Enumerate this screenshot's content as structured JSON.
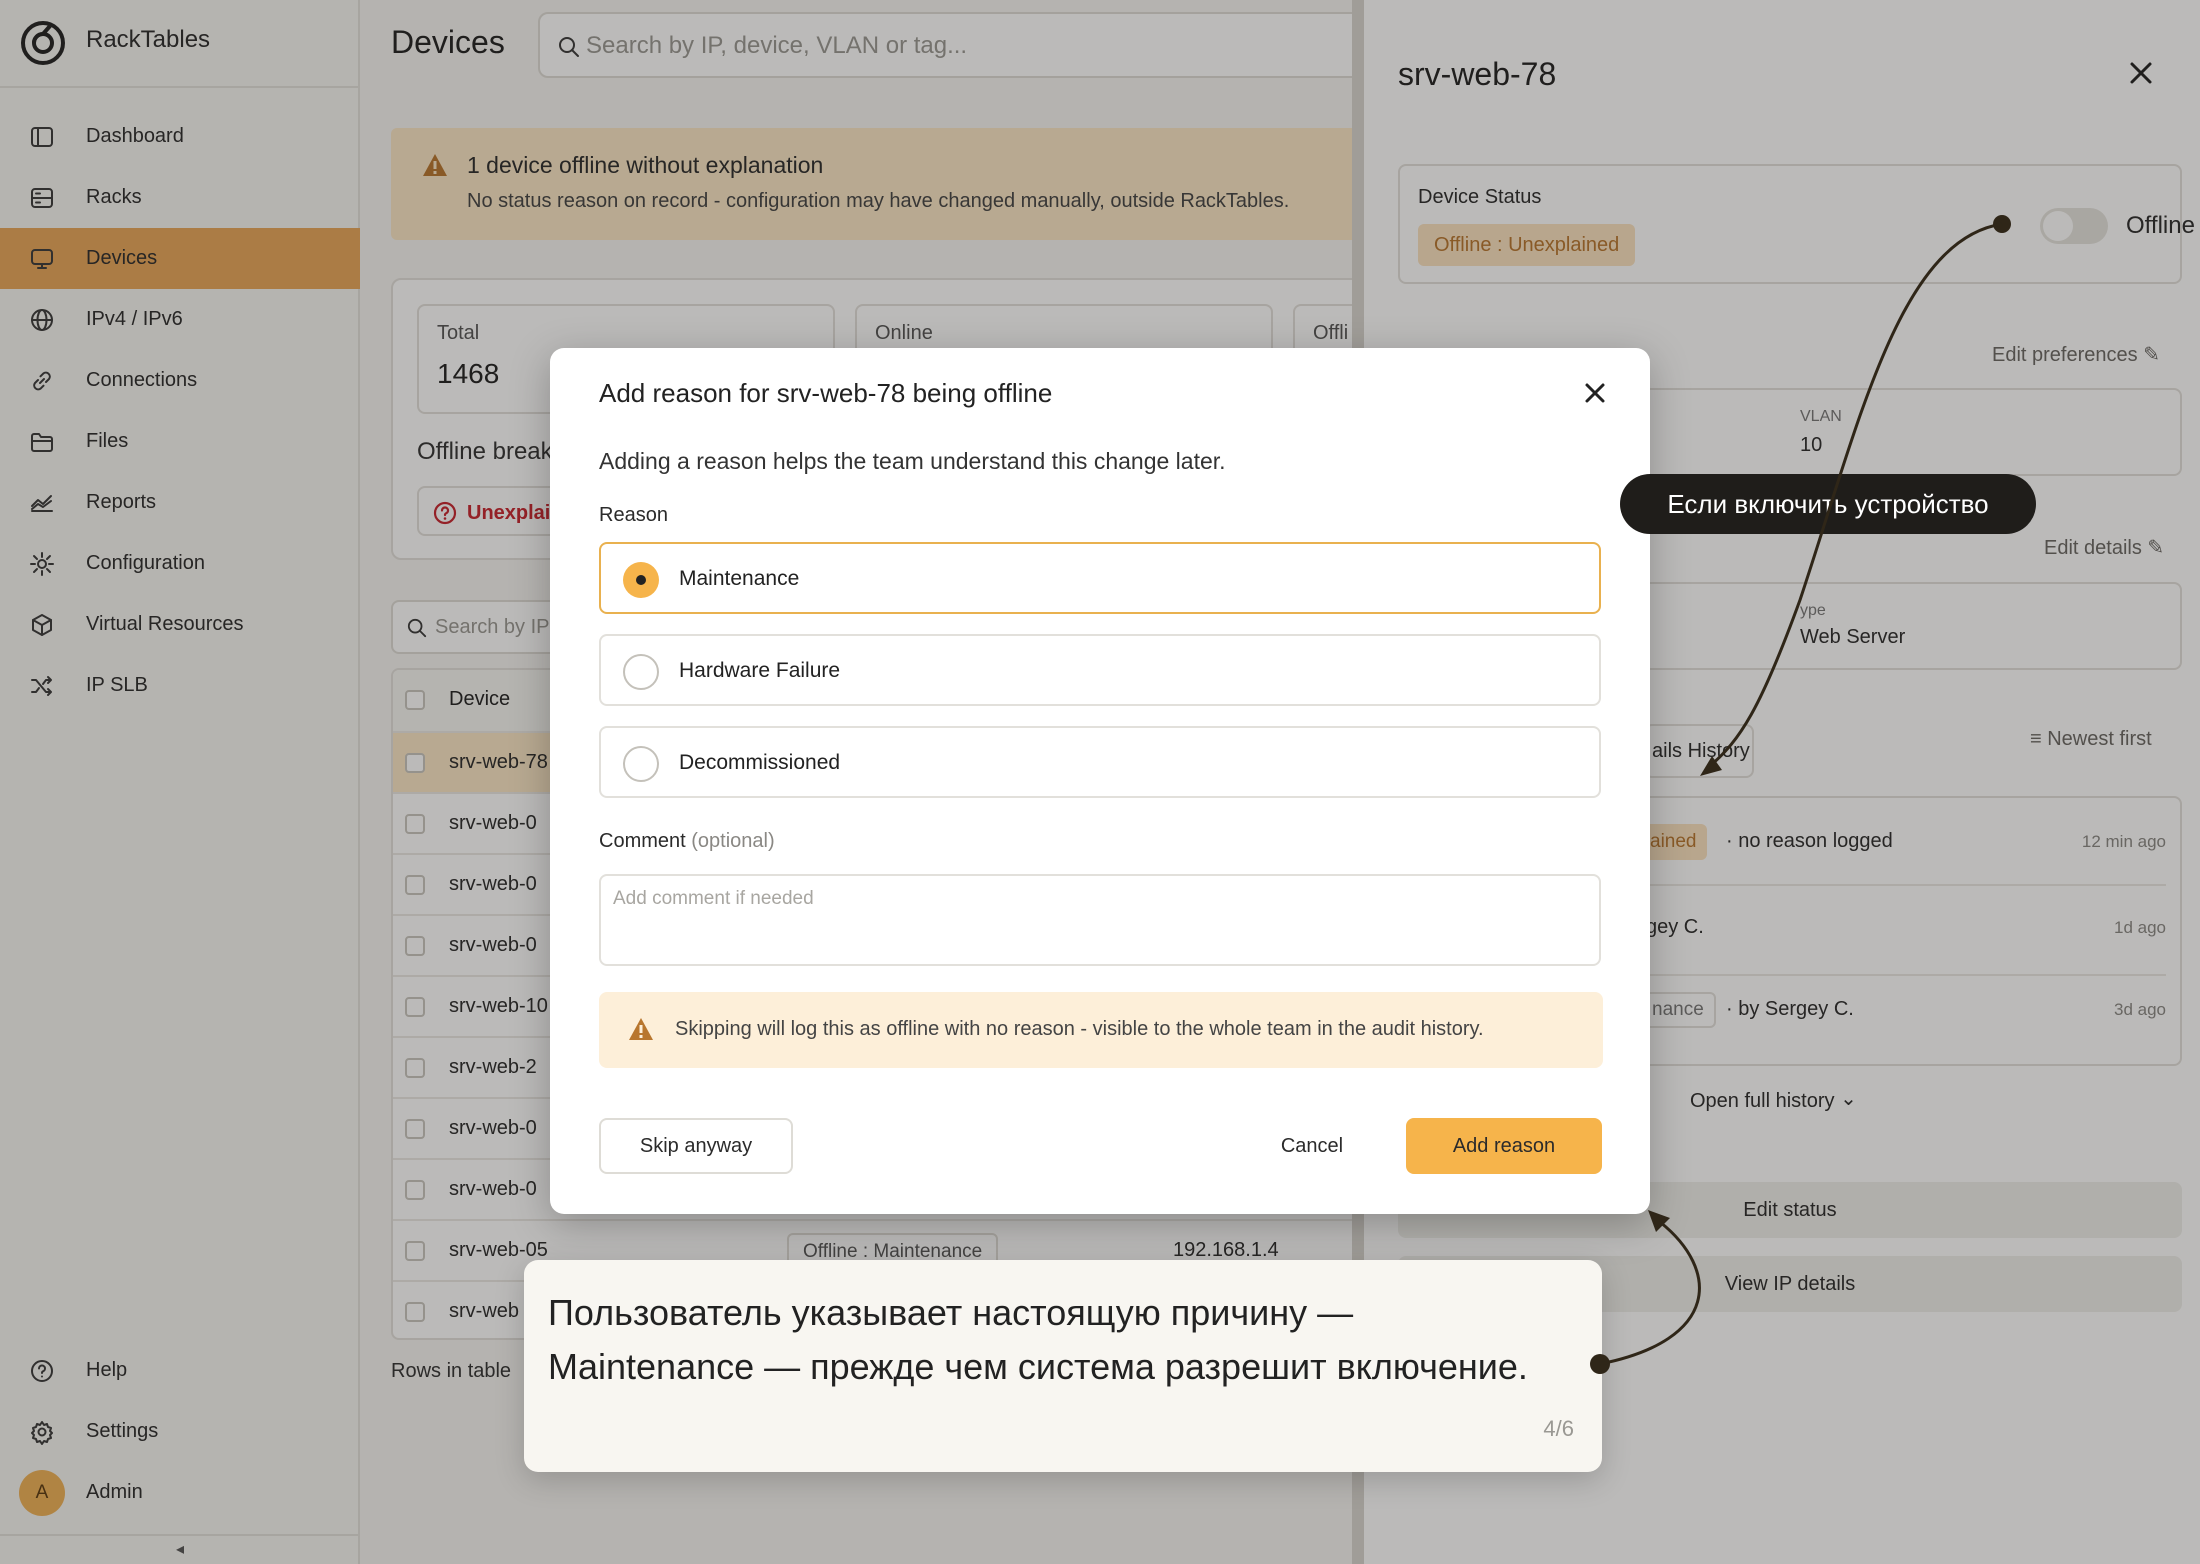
{
  "app": {
    "name": "RackTables"
  },
  "sidebar": {
    "items": [
      {
        "label": "Dashboard",
        "icon": "dashboard-icon"
      },
      {
        "label": "Racks",
        "icon": "rack-icon"
      },
      {
        "label": "Devices",
        "icon": "monitor-icon",
        "active": true
      },
      {
        "label": "IPv4 / IPv6",
        "icon": "globe-icon"
      },
      {
        "label": "Connections",
        "icon": "link-icon"
      },
      {
        "label": "Files",
        "icon": "folder-icon"
      },
      {
        "label": "Reports",
        "icon": "chart-icon"
      },
      {
        "label": "Configuration",
        "icon": "cog-icon"
      },
      {
        "label": "Virtual Resources",
        "icon": "cube-icon"
      },
      {
        "label": "IP SLB",
        "icon": "shuffle-icon"
      }
    ],
    "bottom": [
      {
        "label": "Help",
        "icon": "help-icon"
      },
      {
        "label": "Settings",
        "icon": "settings-icon"
      }
    ],
    "user": {
      "initial": "A",
      "name": "Admin"
    },
    "collapse_glyph": "◂"
  },
  "main": {
    "title": "Devices",
    "search_placeholder": "Search by IP, device, VLAN or tag...",
    "banner": {
      "title": "1 device offline without explanation",
      "subtitle": "No status reason on record - configuration may have changed manually, outside RackTables."
    },
    "stats": [
      {
        "label": "Total",
        "value": "1468"
      },
      {
        "label": "Online",
        "value": ""
      },
      {
        "label": "Offli",
        "value": ""
      }
    ],
    "offline_breakdown_label": "Offline break",
    "unexplained_pill": "Unexplai",
    "table_search_placeholder": "Search by IP",
    "table": {
      "header": "Device",
      "rows": [
        {
          "device": "srv-web-78",
          "selected": true
        },
        {
          "device": "srv-web-0"
        },
        {
          "device": "srv-web-0"
        },
        {
          "device": "srv-web-0"
        },
        {
          "device": "srv-web-10"
        },
        {
          "device": "srv-web-2"
        },
        {
          "device": "srv-web-0"
        },
        {
          "device": "srv-web-0"
        },
        {
          "device": "srv-web-05",
          "status": "Offline : Maintenance",
          "ip": "192.168.1.4"
        },
        {
          "device": "srv-web"
        }
      ]
    },
    "rows_label": "Rows in table"
  },
  "panel": {
    "title": "srv-web-78",
    "device_status_label": "Device Status",
    "status_chip": "Offline : Unexplained",
    "toggle_label": "Offline",
    "edit_preferences": "Edit preferences",
    "vlan_label": "VLAN",
    "vlan_value": "10",
    "edit_details": "Edit details",
    "type_label": "ype",
    "type_value": "Web Server",
    "history_tab": "ails History",
    "sort_label": "Newest first",
    "history": [
      {
        "chip": "ained",
        "text": "· no reason logged",
        "ago": "12 min ago"
      },
      {
        "chip": "",
        "text": "gey C.",
        "ago": "1d ago"
      },
      {
        "chip": "nance",
        "text": "· by Sergey C.",
        "ago": "3d ago"
      }
    ],
    "open_full_history": "Open full history",
    "edit_status": "Edit status",
    "view_ip": "View IP details"
  },
  "modal": {
    "title": "Add reason for srv-web-78 being offline",
    "subtitle": "Adding a reason helps the team understand this change later.",
    "reason_label": "Reason",
    "options": [
      {
        "label": "Maintenance",
        "selected": true
      },
      {
        "label": "Hardware Failure",
        "selected": false
      },
      {
        "label": "Decommissioned",
        "selected": false
      }
    ],
    "comment_label": "Comment",
    "comment_optional": "(optional)",
    "comment_placeholder": "Add comment if needed",
    "warning": "Skipping will log this as offline with no reason - visible to the whole team in the audit history.",
    "skip": "Skip anyway",
    "cancel": "Cancel",
    "add": "Add reason"
  },
  "tour": {
    "tooltip": "Если включить устройство",
    "card_text": "Пользователь указывает настоящую причину — Maintenance — прежде чем система разрешит включение.",
    "progress": "4/6"
  }
}
